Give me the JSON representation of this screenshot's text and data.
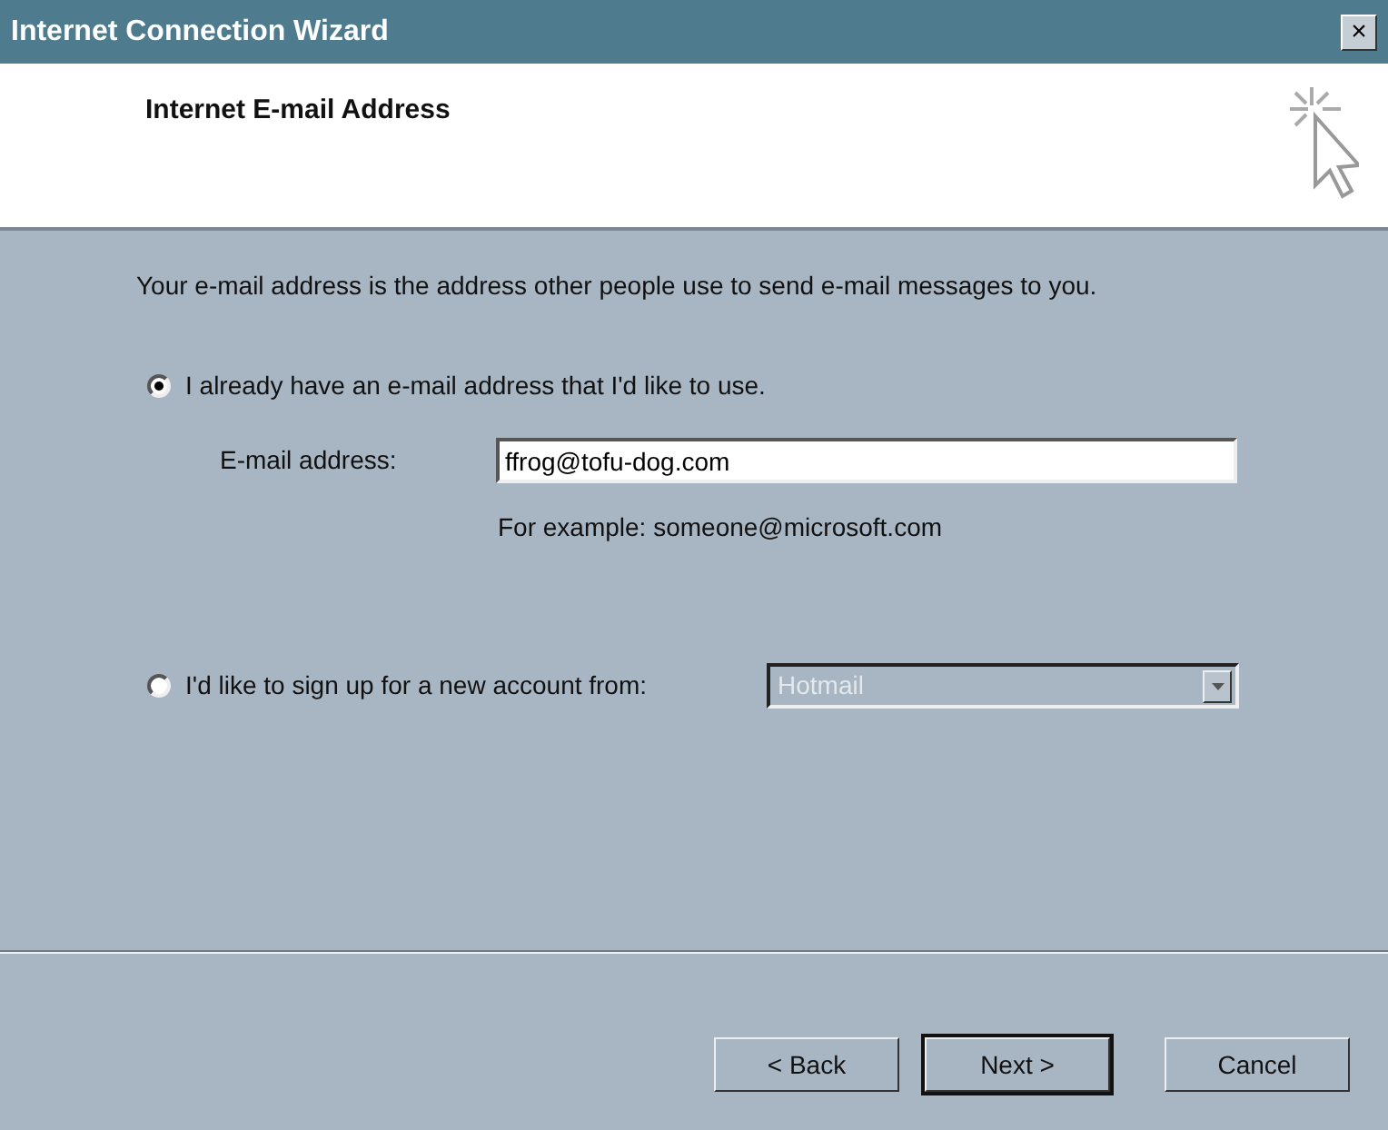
{
  "window": {
    "title": "Internet Connection Wizard",
    "close_label": "×"
  },
  "header": {
    "title": "Internet E-mail Address"
  },
  "intro": "Your e-mail address is the address other people use to send e-mail messages to you.",
  "options": [
    {
      "label": "I already have an e-mail address that I'd like to use.",
      "selected": true
    },
    {
      "label": "I'd like to sign up for a new account from:",
      "selected": false
    }
  ],
  "email": {
    "label": "E-mail address:",
    "value": "ffrog@tofu-dog.com",
    "hint": "For example: someone@microsoft.com"
  },
  "provider": {
    "value": "Hotmail",
    "disabled": true
  },
  "buttons": [
    {
      "label": "< Back",
      "default": false
    },
    {
      "label": "Next >",
      "default": true
    },
    {
      "label": "Cancel",
      "default": false
    }
  ]
}
